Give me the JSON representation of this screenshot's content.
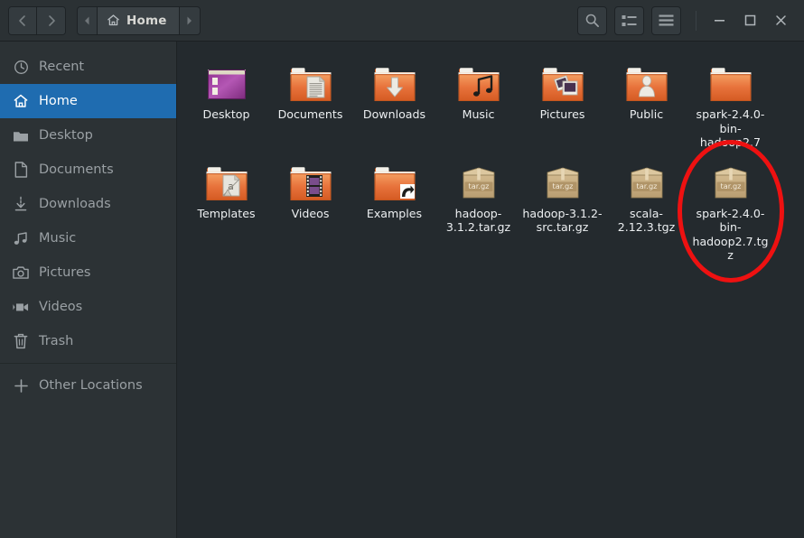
{
  "window": {
    "title": "Home",
    "controls": {
      "minimize": "–",
      "maximize": "□",
      "close": "×"
    }
  },
  "header": {
    "back_label": "‹",
    "forward_label": "›",
    "path_prev_label": "◂",
    "path_next_label": "▸",
    "current_path_label": "Home",
    "search_icon": "search-icon",
    "view_toggle_icon": "list-view-icon",
    "menu_icon": "hamburger-menu-icon"
  },
  "sidebar": {
    "items": [
      {
        "label": "Recent",
        "icon": "clock-icon",
        "selected": false
      },
      {
        "label": "Home",
        "icon": "home-icon",
        "selected": true
      },
      {
        "label": "Desktop",
        "icon": "folder-icon",
        "selected": false
      },
      {
        "label": "Documents",
        "icon": "document-icon",
        "selected": false
      },
      {
        "label": "Downloads",
        "icon": "download-icon",
        "selected": false
      },
      {
        "label": "Music",
        "icon": "music-icon",
        "selected": false
      },
      {
        "label": "Pictures",
        "icon": "camera-icon",
        "selected": false
      },
      {
        "label": "Videos",
        "icon": "video-icon",
        "selected": false
      },
      {
        "label": "Trash",
        "icon": "trash-icon",
        "selected": false
      }
    ],
    "other_locations": {
      "label": "Other Locations",
      "icon": "plus-icon"
    }
  },
  "files": [
    {
      "name": "Desktop",
      "type": "folder-desktop"
    },
    {
      "name": "Documents",
      "type": "folder-documents"
    },
    {
      "name": "Downloads",
      "type": "folder-downloads"
    },
    {
      "name": "Music",
      "type": "folder-music"
    },
    {
      "name": "Pictures",
      "type": "folder-pictures"
    },
    {
      "name": "Public",
      "type": "folder-public"
    },
    {
      "name": "spark-2.4.0-bin-hadoop2.7",
      "type": "folder-plain"
    },
    {
      "name": "Templates",
      "type": "folder-templates"
    },
    {
      "name": "Videos",
      "type": "folder-videos"
    },
    {
      "name": "Examples",
      "type": "folder-link"
    },
    {
      "name": "hadoop-3.1.2.tar.gz",
      "type": "archive",
      "badge": "tar.gz"
    },
    {
      "name": "hadoop-3.1.2-src.tar.gz",
      "type": "archive",
      "badge": "tar.gz"
    },
    {
      "name": "scala-2.12.3.tgz",
      "type": "archive",
      "badge": "tar.gz"
    },
    {
      "name": "spark-2.4.0-bin-hadoop2.7.tgz",
      "type": "archive",
      "badge": "tar.gz",
      "annotated": true
    }
  ],
  "annotation": {
    "shape": "ellipse",
    "color": "#ee1111",
    "target": "spark-2.4.0-bin-hadoop2.7.tgz"
  },
  "colors": {
    "headerbar": "#2b3134",
    "sidebar": "#2c3235",
    "content": "#242a2e",
    "selection": "#1f6cb0",
    "folder_orange": "#e8703a",
    "archive_tan": "#c9ae82",
    "annotation_red": "#ee1111"
  }
}
